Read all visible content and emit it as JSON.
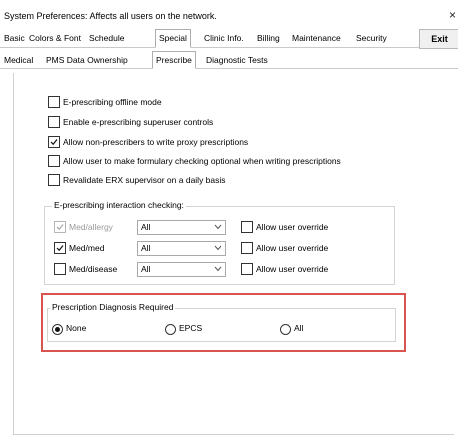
{
  "window": {
    "title": "System Preferences: Affects all users on the network.",
    "close_glyph": "×"
  },
  "main_tabs": [
    "Basic",
    "Colors & Font",
    "Schedule",
    "Special",
    "Clinic Info.",
    "Billing",
    "Maintenance",
    "Security"
  ],
  "active_main_tab": "Special",
  "exit_label": "Exit",
  "sub_tabs": [
    "Medical",
    "PMS Data Ownership",
    "Prescribe",
    "Diagnostic Tests"
  ],
  "active_sub_tab": "Prescribe",
  "options": [
    {
      "label": "E-prescribing offline mode",
      "checked": false
    },
    {
      "label": "Enable e-prescribing superuser controls",
      "checked": false
    },
    {
      "label": "Allow non-prescribers to write proxy prescriptions",
      "checked": true
    },
    {
      "label": "Allow user to make formulary checking optional when writing prescriptions",
      "checked": false
    },
    {
      "label": "Revalidate ERX supervisor on a daily basis",
      "checked": false
    }
  ],
  "interaction_group": {
    "title": "E-prescribing interaction checking:",
    "rows": [
      {
        "label": "Med/allergy",
        "checked": true,
        "disabled": true,
        "select_value": "All",
        "override_label": "Allow user override"
      },
      {
        "label": "Med/med",
        "checked": true,
        "disabled": false,
        "select_value": "All",
        "override_label": "Allow user override"
      },
      {
        "label": "Med/disease",
        "checked": false,
        "disabled": false,
        "select_value": "All",
        "override_label": "Allow user override"
      }
    ]
  },
  "diagnosis_group": {
    "title": "Prescription Diagnosis Required",
    "options": [
      {
        "label": "None",
        "selected": true
      },
      {
        "label": "EPCS",
        "selected": false
      },
      {
        "label": "All",
        "selected": false
      }
    ]
  },
  "colors": {
    "highlight_border": "#d9534f"
  }
}
